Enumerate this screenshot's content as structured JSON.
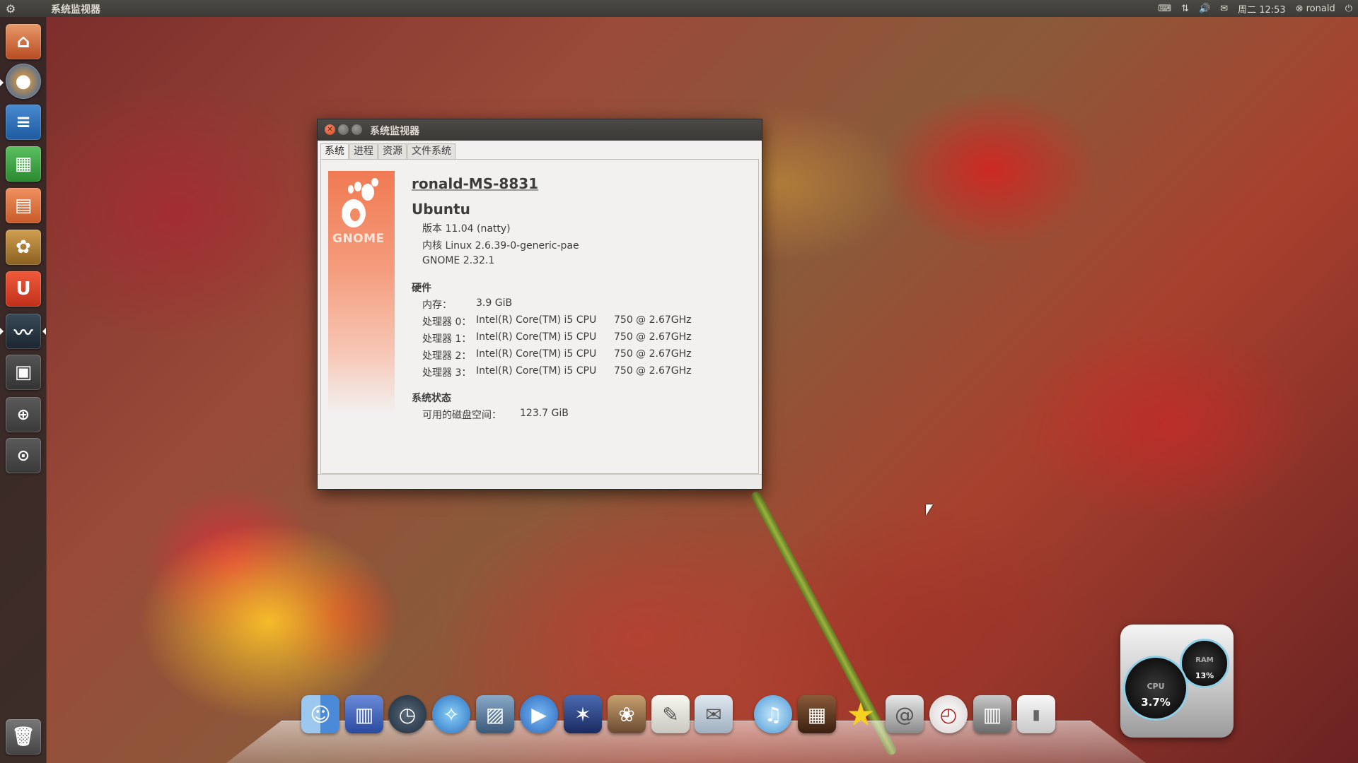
{
  "top_panel": {
    "app_title": "系统监视器",
    "clock": "周二 12:53",
    "user": "ronald"
  },
  "window": {
    "title": "系统监视器",
    "tabs": [
      "系统",
      "进程",
      "资源",
      "文件系统"
    ],
    "active_tab": "系统",
    "logo_text": "GNOME",
    "hostname": "ronald-MS-8831",
    "distro": "Ubuntu",
    "version_line": "版本 11.04 (natty)",
    "kernel_line": "内核 Linux 2.6.39-0-generic-pae",
    "gnome_line": "GNOME 2.32.1",
    "hardware_heading": "硬件",
    "memory_label": "内存：",
    "memory_value": "3.9 GiB",
    "processors": [
      {
        "label": "处理器 0：",
        "model": "Intel(R) Core(TM) i5 CPU",
        "speed": "750 @ 2.67GHz"
      },
      {
        "label": "处理器 1：",
        "model": "Intel(R) Core(TM) i5 CPU",
        "speed": "750 @ 2.67GHz"
      },
      {
        "label": "处理器 2：",
        "model": "Intel(R) Core(TM) i5 CPU",
        "speed": "750 @ 2.67GHz"
      },
      {
        "label": "处理器 3：",
        "model": "Intel(R) Core(TM) i5 CPU",
        "speed": "750 @ 2.67GHz"
      }
    ],
    "status_heading": "系统状态",
    "disk_label": "可用的磁盘空间：",
    "disk_value": "123.7 GiB"
  },
  "gauges": {
    "cpu_label": "CPU",
    "cpu_value": "3.7%",
    "ram_label": "RAM",
    "ram_value": "13%"
  },
  "launcher_icons": [
    "home-folder-icon",
    "firefox-icon",
    "writer-icon",
    "calc-icon",
    "impress-icon",
    "software-center-icon",
    "ubuntu-one-icon",
    "system-monitor-icon",
    "workspace-switcher-icon",
    "zoom-in-icon",
    "zoom-fit-icon",
    "trash-icon"
  ],
  "dock_icons": [
    "finder-icon",
    "dashboard-icon",
    "time-machine-icon",
    "safari-icon",
    "preview-icon",
    "facetime-icon",
    "imovie-icon",
    "iphoto-icon",
    "textedit-icon",
    "mail-package-icon",
    "itunes-icon",
    "photo-booth-icon",
    "favorites-star-icon",
    "address-book-icon",
    "clock-icon",
    "trash-can-icon",
    "document-icon"
  ],
  "colors": {
    "panel": "#3c3b37",
    "window_bg": "#f2f1f0",
    "gnome_orange": "#f07a52",
    "close_button": "#d4401c"
  }
}
